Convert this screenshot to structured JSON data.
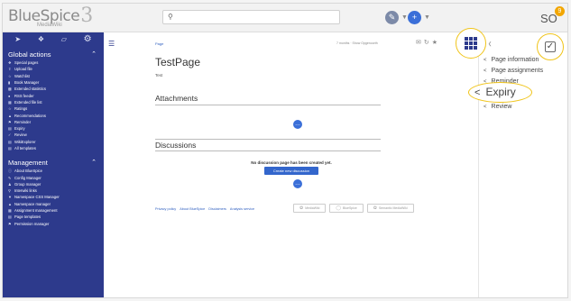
{
  "header": {
    "logo_text": "BlueSpice",
    "logo_num": "3",
    "logo_sub": "MediaWiki",
    "search_icon": "search-icon",
    "user_initials": "SO",
    "notifications_count": "9",
    "colors": {
      "blue": "#3b6fd8",
      "notif": "#f2a600"
    }
  },
  "sidebar": {
    "global_title": "Global actions",
    "global_items": [
      "Special pages",
      "Upload file",
      "Watchlist",
      "Book Manager",
      "Extended statistics",
      "RSS feeder",
      "Extended file list",
      "Ratings",
      "Recommendations",
      "Reminder",
      "Expiry",
      "Review",
      "WikiExplorer",
      "All templates"
    ],
    "management_title": "Management",
    "management_items": [
      "About BlueSpice",
      "Config Manager",
      "Group manager",
      "Interwiki links",
      "Namespace CSS Manager",
      "Namespace manager",
      "Assignment management",
      "Page templates",
      "Permission manager"
    ],
    "color": "#2d3a8c"
  },
  "content": {
    "breadcrumb": "Page",
    "author_info": "7 months · Show Opgenoorth",
    "title": "TestPage",
    "body": "Test",
    "attachments_title": "Attachments",
    "discussions_title": "Discussions",
    "no_discussion": "No discussion page has been created yet.",
    "create_discussion": "Create new discussion",
    "footer_links": [
      "Privacy policy",
      "About BlueSpice",
      "Disclaimers",
      "Analysis service"
    ],
    "footer_badges": [
      "MediaWiki",
      "BlueSpice",
      "Semantic MediaWiki"
    ]
  },
  "rpanel": {
    "items": [
      "Page information",
      "Page assignments",
      "Reminder"
    ],
    "highlight": "Expiry",
    "last_item": "Review",
    "highlight_color": "#f0c419"
  }
}
